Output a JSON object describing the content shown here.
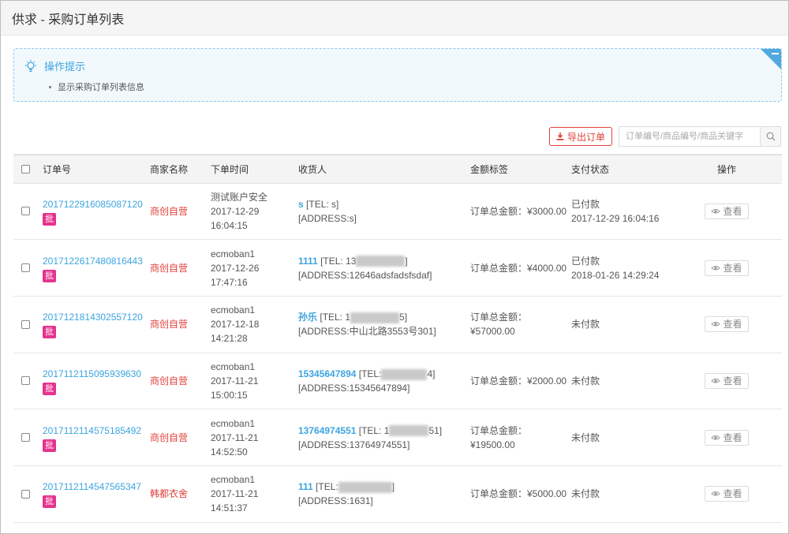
{
  "title": "供求 - 采购订单列表",
  "tips": {
    "heading": "操作提示",
    "items": [
      "显示采购订单列表信息"
    ]
  },
  "toolbar": {
    "export_label": "导出订单",
    "search_placeholder": "订单编号/商品编号/商品关键字"
  },
  "columns": [
    "订单号",
    "商家名称",
    "下单时间",
    "收货人",
    "金额标签",
    "支付状态",
    "操作"
  ],
  "rows": [
    {
      "order_no": "2017122916085087120",
      "badge": "批",
      "merchant": "商创自营",
      "user": "测试账户安全",
      "date": "2017-12-29",
      "time": "16:04:15",
      "name": "s",
      "tel": "[TEL: s]",
      "tel_end": "",
      "address": "[ADDRESS:s]",
      "amount_line1": "订单总金额：¥3000.00",
      "amount_line2": "",
      "pay_status": "已付款",
      "pay_time": "2017-12-29 16:04:16",
      "view": "查看"
    },
    {
      "order_no": "2017122617480816443",
      "badge": "批",
      "merchant": "商创自营",
      "user": "ecmoban1",
      "date": "2017-12-26",
      "time": "17:47:16",
      "name": "1111",
      "tel": "[TEL: 13",
      "tel_end": "]",
      "address": "[ADDRESS:12646adsfadsfsdaf]",
      "amount_line1": "订单总金额：¥4000.00",
      "amount_line2": "",
      "pay_status": "已付款",
      "pay_time": "2018-01-26 14:29:24",
      "view": "查看"
    },
    {
      "order_no": "2017121814302557120",
      "badge": "批",
      "merchant": "商创自营",
      "user": "ecmoban1",
      "date": "2017-12-18",
      "time": "14:21:28",
      "name": "孙乐",
      "tel": "[TEL: 1",
      "tel_end": "5]",
      "address": "[ADDRESS:中山北路3553号301]",
      "amount_line1": "订单总金额：",
      "amount_line2": "¥57000.00",
      "pay_status": "未付款",
      "pay_time": "",
      "view": "查看"
    },
    {
      "order_no": "2017112115095939630",
      "badge": "批",
      "merchant": "商创自营",
      "user": "ecmoban1",
      "date": "2017-11-21",
      "time": "15:00:15",
      "name": "15345647894",
      "tel": "[TEL:",
      "tel_end": "4]",
      "address": "[ADDRESS:15345647894]",
      "amount_line1": "订单总金额：¥2000.00",
      "amount_line2": "",
      "pay_status": "未付款",
      "pay_time": "",
      "view": "查看"
    },
    {
      "order_no": "2017112114575185492",
      "badge": "批",
      "merchant": "商创自营",
      "user": "ecmoban1",
      "date": "2017-11-21",
      "time": "14:52:50",
      "name": "13764974551",
      "tel": "[TEL: 1",
      "tel_end": "51]",
      "address": "[ADDRESS:13764974551]",
      "amount_line1": "订单总金额：",
      "amount_line2": "¥19500.00",
      "pay_status": "未付款",
      "pay_time": "",
      "view": "查看"
    },
    {
      "order_no": "2017112114547565347",
      "badge": "批",
      "merchant": "韩都衣舍",
      "user": "ecmoban1",
      "date": "2017-11-21",
      "time": "14:51:37",
      "name": "111",
      "tel": "[TEL:",
      "tel_end": "]",
      "address": "[ADDRESS:1631]",
      "amount_line1": "订单总金额：¥5000.00",
      "amount_line2": "",
      "pay_status": "未付款",
      "pay_time": "",
      "view": "查看"
    }
  ]
}
